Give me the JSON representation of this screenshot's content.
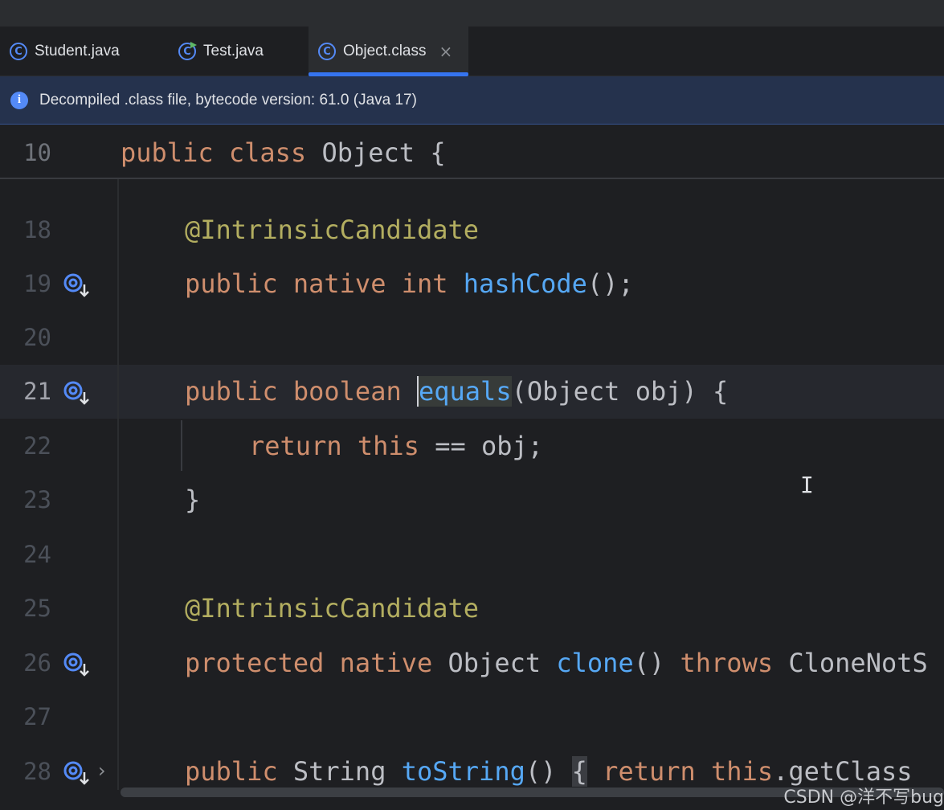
{
  "tabs": [
    {
      "label": "Student.java"
    },
    {
      "label": "Test.java"
    },
    {
      "label": "Object.class",
      "close": "×"
    }
  ],
  "banner": {
    "icon": "i",
    "text": "Decompiled .class file, bytecode version: 61.0 (Java 17)"
  },
  "sticky": {
    "line_number": "10"
  },
  "lines": [
    {
      "n": "18"
    },
    {
      "n": "19"
    },
    {
      "n": "20"
    },
    {
      "n": "21"
    },
    {
      "n": "22"
    },
    {
      "n": "23"
    },
    {
      "n": "24"
    },
    {
      "n": "25"
    },
    {
      "n": "26"
    },
    {
      "n": "27"
    },
    {
      "n": "28"
    }
  ],
  "code": {
    "l10": [
      "public",
      " ",
      "class",
      " Object {"
    ],
    "l18": [
      "@IntrinsicCandidate"
    ],
    "l19": [
      "public",
      " ",
      "native",
      " ",
      "int",
      " ",
      "hashCode",
      "();"
    ],
    "l21": [
      "public",
      " ",
      "boolean",
      " ",
      "equals",
      "(Object obj) {"
    ],
    "l22": [
      "return",
      " ",
      "this",
      " == obj;"
    ],
    "l23": [
      "}"
    ],
    "l25": [
      "@IntrinsicCandidate"
    ],
    "l26": [
      "protected",
      " ",
      "native",
      " Object ",
      "clone",
      "() ",
      "throws",
      " CloneNotS"
    ],
    "l28": [
      "public",
      " String ",
      "toString",
      "() ",
      "{",
      " ",
      "return",
      " ",
      "this",
      ".getClass"
    ]
  },
  "icons": {
    "override": "override-gutter-icon",
    "fold": "›",
    "cursor": "I"
  },
  "watermark": "CSDN @洋不写bug",
  "colors": {
    "keyword": "#cf8e6d",
    "function": "#56a8f5",
    "annotation": "#b3ae60",
    "text": "#bcbec4",
    "accent": "#3574f0"
  }
}
